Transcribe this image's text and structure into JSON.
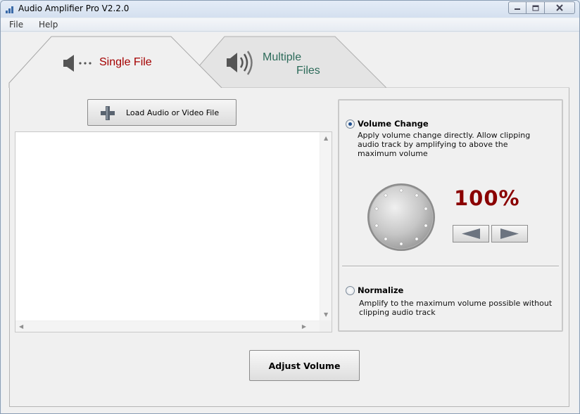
{
  "window": {
    "title": "Audio Amplifier Pro V2.2.0"
  },
  "menu": {
    "items": [
      "File",
      "Help"
    ]
  },
  "tabs": {
    "single": {
      "label": "Single File",
      "icon": "speaker-icon"
    },
    "multiple": {
      "label_line1": "Multiple",
      "label_line2": "Files",
      "icon": "speaker-loud-icon"
    }
  },
  "load_button": {
    "label": "Load Audio or Video File",
    "icon": "plus-icon"
  },
  "options": {
    "volume_change": {
      "title": "Volume Change",
      "desc_line1": "Apply volume change directly. Allow clipping",
      "desc_line2": "audio track by amplifying to above the",
      "desc_line3": "maximum volume",
      "checked": true
    },
    "normalize": {
      "title": "Normalize",
      "desc_line1": "Amplify to the maximum volume possible without",
      "desc_line2": "clipping audio track",
      "checked": false
    }
  },
  "volume": {
    "value_text": "100%"
  },
  "adjust_button": {
    "label": "Adjust Volume"
  },
  "colors": {
    "accent_red": "#a40000",
    "tab_teal": "#2d6b5a",
    "percent_red": "#8a0000"
  }
}
